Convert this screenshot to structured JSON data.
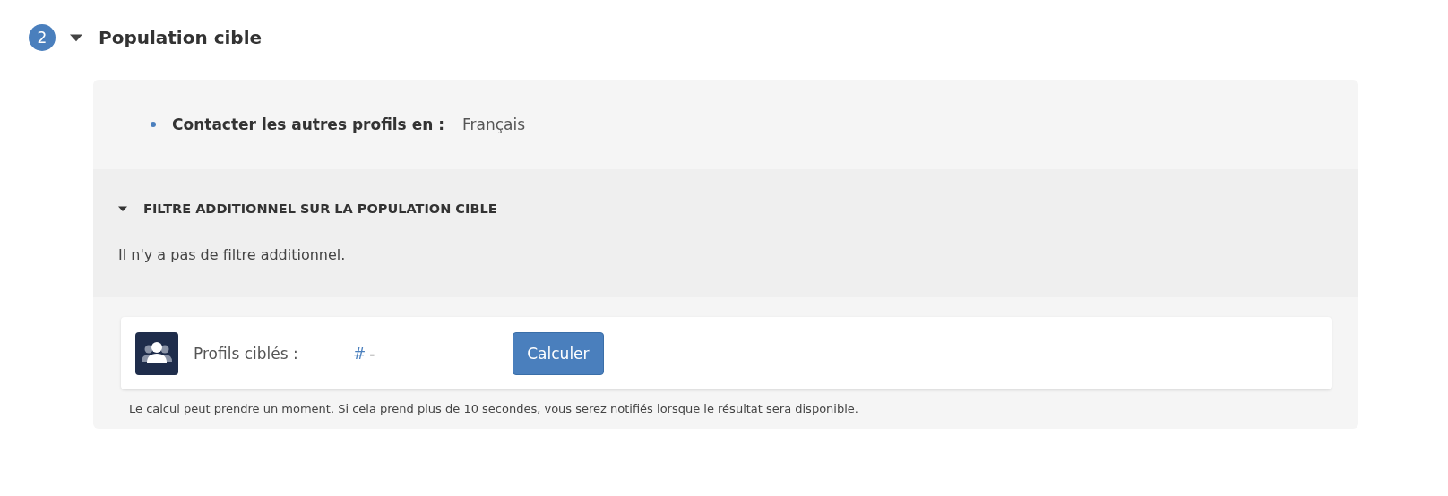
{
  "section": {
    "step": "2",
    "title": "Population cible",
    "expanded": true
  },
  "criteria": [
    {
      "label": "Contacter les autres profils en :",
      "value": "Français"
    }
  ],
  "filter": {
    "title": "FILTRE ADDITIONNEL SUR LA POPULATION CIBLE",
    "expanded": true,
    "message": "Il n'y a pas de filtre additionnel."
  },
  "count_card": {
    "label": "Profils ciblés :",
    "hash": "#",
    "value": "-",
    "button": "Calculer"
  },
  "note": "Le calcul peut prendre un moment. Si cela prend plus de 10 secondes, vous serez notifiés lorsque le résultat sera disponible."
}
